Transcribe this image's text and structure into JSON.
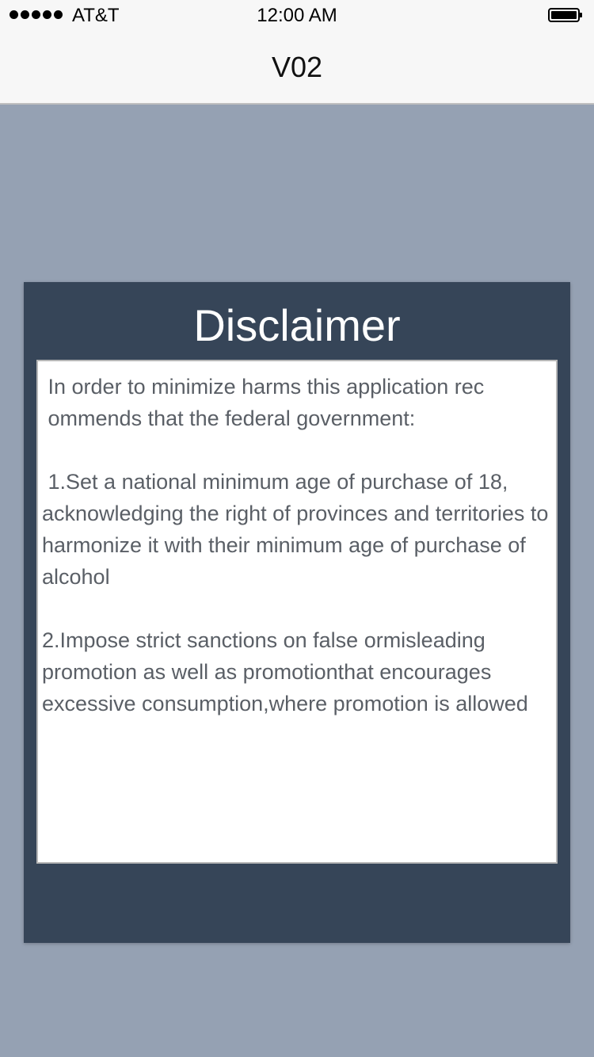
{
  "status_bar": {
    "carrier": "AT&T",
    "time": "12:00 AM",
    "signal_bars": 5,
    "battery_level": 1.0,
    "signal_icon": "signal-dots-icon",
    "battery_icon": "battery-icon"
  },
  "nav": {
    "title": "V02"
  },
  "disclaimer": {
    "title": "Disclaimer",
    "body": " In order to minimize harms this application rec\n ommends that the federal government:\n\n 1.Set a national minimum age of purchase of 18, acknowledging the right of provinces and territories to harmonize it with their minimum age of purchase of alcohol\n\n2.Impose strict sanctions on false ormisleading promotion as well as promotionthat encourages excessive consumption,where promotion is allowed"
  },
  "colors": {
    "background": "#95a1b3",
    "card": "#364558",
    "text": "#5a5f66",
    "bar": "#f7f7f7"
  }
}
